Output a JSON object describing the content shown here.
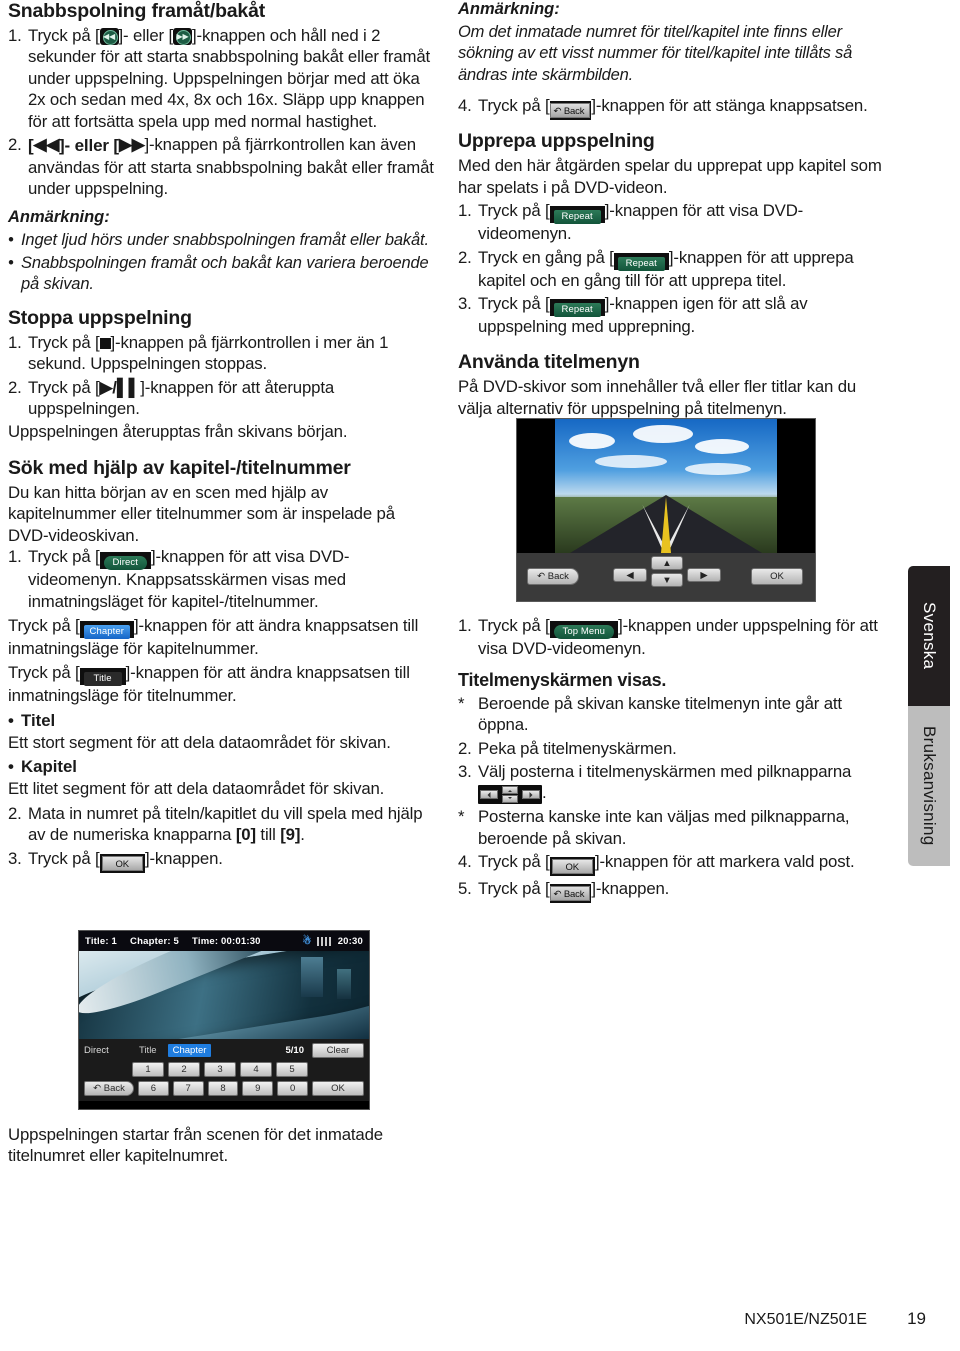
{
  "page": {
    "model": "NX501E/NZ501E",
    "number": "19"
  },
  "side_tabs": [
    {
      "label": "Svenska",
      "style": "dark"
    },
    {
      "label": "Bruksanvisning",
      "style": "grey"
    }
  ],
  "left_column": {
    "section1": {
      "heading": "Snabbspolning framåt/bakåt",
      "items": [
        {
          "num": "1.",
          "pre": "Tryck på [",
          "key1": "rewind-round",
          "mid": "]- eller [",
          "key2": "forward-round",
          "post": "]-knappen och håll ned i 2 sekunder för att starta snabbspolning bakåt eller framåt under uppspelning. Uppspelningen börjar med att öka 2x och sedan med 4x, 8x och 16x. Släpp upp knappen för att fortsätta spela upp med normal hastighet."
        },
        {
          "num": "2.",
          "pre": "[",
          "key1": "◀◀",
          "mid": "]- eller [",
          "key2": "▶▶",
          "post": "]-knappen på fjärrkontrollen kan även användas för att starta snabbspolning bakåt eller framåt under uppspelning."
        }
      ]
    },
    "note1": {
      "heading": "Anmärkning:",
      "items": [
        "Inget ljud hörs under snabbspolningen framåt eller bakåt.",
        "Snabbspolningen framåt och bakåt kan variera beroende på skivan."
      ]
    },
    "section2": {
      "heading": "Stoppa uppspelning",
      "item1_pre": "Tryck på [",
      "item1_key": "stop-square",
      "item1_post": "]-knappen på fjärrkontrollen i mer än 1 sekund. Uppspelningen stoppas.",
      "item1_num": "1.",
      "item2_num": "2.",
      "item2_pre": "Tryck på [",
      "item2_key": "▶/ll",
      "item2_post": "]-knappen för att återuppta uppspelningen.",
      "trailing": "Uppspelningen återupptas från skivans början."
    },
    "section3": {
      "heading": "Sök med hjälp av kapitel-/titelnummer",
      "intro": "Du kan hitta början av en scen med hjälp av kapitelnummer eller titelnummer som är inspelade på DVD-videoskivan.",
      "item1_num": "1.",
      "item1_pre": "Tryck på [",
      "item1_key": "Direct",
      "item1_post": "]-knappen för att visa DVD-videomenyn. Knappsatsskärmen visas med inmatningsläget för kapitel-/titelnummer.",
      "para_chapter_pre": "Tryck på [",
      "para_chapter_key": "Chapter",
      "para_chapter_post": "]-knappen för att ändra knappsatsen till inmatningsläge för kapitelnummer.",
      "para_title_pre": "Tryck på [",
      "para_title_key": "Title",
      "para_title_post": "]-knappen för att ändra knappsatsen till inmatningsläge för titelnummer.",
      "bullet1_label": "Titel",
      "bullet1_text": "Ett stort segment för att dela dataområdet för skivan.",
      "bullet2_label": "Kapitel",
      "bullet2_text": "Ett litet segment för att dela dataområdet för skivan.",
      "item2_num": "2.",
      "item2_text_a": "Mata in numret på titeln/kapitlet du vill spela med hjälp av de numeriska knapparna ",
      "item2_bold_a": "[0]",
      "item2_text_b": " till ",
      "item2_bold_b": "[9]",
      "item2_text_c": ".",
      "item3_num": "3.",
      "item3_pre": "Tryck på [",
      "item3_key": "OK",
      "item3_post": "]-knappen."
    },
    "closing": "Uppspelningen startar från scenen för det inmatade titelnumret eller kapitelnumret."
  },
  "right_column": {
    "note1": {
      "heading": "Anmärkning:",
      "text": "Om det inmatade numret för titel/kapitel inte finns eller sökning av ett visst nummer för titel/kapitel inte tillåts så ändras inte skärmbilden."
    },
    "item4": {
      "num": "4.",
      "pre": "Tryck på [",
      "key": "Back",
      "post": "]-knappen för att stänga knappsatsen."
    },
    "section_repeat": {
      "heading": "Upprepa uppspelning",
      "intro": "Med den här åtgärden spelar du upprepat upp kapitel som har spelats i på DVD-videon.",
      "items": [
        {
          "num": "1.",
          "pre": "Tryck på [",
          "key": "Repeat",
          "post": "]-knappen för att visa DVD-videomenyn."
        },
        {
          "num": "2.",
          "pre": "Tryck en gång på [",
          "key": "Repeat",
          "post": "]-knappen för att upprepa kapitel och en gång till för att upprepa titel."
        },
        {
          "num": "3.",
          "pre": "Tryck på [",
          "key": "Repeat",
          "post": "]-knappen igen för att slå av uppspelning med upprepning."
        }
      ]
    },
    "section_titlemenu": {
      "heading": "Använda titelmenyn",
      "intro": "På DVD-skivor som innehåller två eller fler titlar kan du välja alternativ för uppspelning på titelmenyn.",
      "item1": {
        "num": "1.",
        "pre": "Tryck på [",
        "key": "Top Menu",
        "post": "]-knappen under uppspelning för att visa DVD-videomenyn."
      },
      "subheading": "Titelmenyskärmen visas.",
      "star1": {
        "num": "*",
        "text": "Beroende på skivan kanske titelmenyn inte går att öppna."
      },
      "item2": {
        "num": "2.",
        "text": "Peka på titelmenyskärmen."
      },
      "item3": {
        "num": "3.",
        "pre": "Välj posterna i titelmenyskärmen med pilknapparna ",
        "key": "arrow-pad",
        "post": "."
      },
      "star2": {
        "num": "*",
        "text": "Posterna kanske inte kan väljas med pilknapparna, beroende på skivan."
      },
      "item4": {
        "num": "4.",
        "pre": "Tryck på [",
        "key": "OK",
        "post": "]-knappen för att markera vald post."
      },
      "item5": {
        "num": "5.",
        "pre": "Tryck på [",
        "key": "Back",
        "post": "]-knappen."
      }
    }
  },
  "screenshot_keypad": {
    "status": {
      "title": "Title: 1",
      "chapter": "Chapter: 5",
      "time": "Time: 00:01:30",
      "bluetooth": "bluetooth-icon",
      "clock": "20:30"
    },
    "mode_label": "Direct",
    "tab_title": "Title",
    "tab_chapter": "Chapter",
    "counter": "5/10",
    "clear": "Clear",
    "back": "Back",
    "keys_row1": [
      "1",
      "2",
      "3",
      "4",
      "5"
    ],
    "keys_row2": [
      "6",
      "7",
      "8",
      "9",
      "0"
    ],
    "ok": "OK"
  },
  "screenshot_titlemenu": {
    "back": "Back",
    "left": "◀",
    "right": "▶",
    "up": "▲",
    "down": "▼",
    "ok": "OK"
  },
  "colors": {
    "green_key": "#1d5c44",
    "blue_chip": "#1f7de0",
    "dark_tab": "#231f20",
    "grey_tab": "#bdbdbd"
  }
}
